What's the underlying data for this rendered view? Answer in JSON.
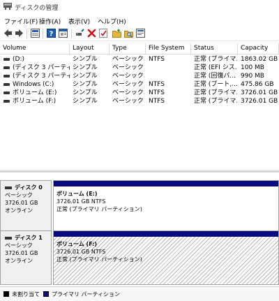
{
  "window": {
    "title": "ディスクの管理"
  },
  "menu": [
    {
      "label": "ファイル(F)"
    },
    {
      "label": "操作(A)"
    },
    {
      "label": "表示(V)"
    },
    {
      "label": "ヘルプ(H)"
    }
  ],
  "toolbar": {
    "icons": [
      "back-arrow-icon",
      "forward-arrow-icon",
      "up-panel-icon",
      "help-icon",
      "properties-icon",
      "connect-icon",
      "delete-x-icon",
      "check-icon",
      "new-folder-icon",
      "search-folder-icon",
      "refresh-panel-icon"
    ],
    "colors": {
      "delete": "#cc1111",
      "folder": "#e8b83a",
      "panel": "#1a5fb4"
    }
  },
  "volumes": {
    "columns": [
      "Volume",
      "Layout",
      "Type",
      "File System",
      "Status",
      "Capacity"
    ],
    "rows": [
      {
        "volume": "(D:)",
        "layout": "シンプル",
        "type": "ベーシック",
        "fs": "NTFS",
        "status": "正常 (プライマ...",
        "capacity": "1863.02 GB"
      },
      {
        "volume": "(ディスク 3 パーティシ...",
        "layout": "シンプル",
        "type": "ベーシック",
        "fs": "",
        "status": "正常 (EFI シス...",
        "capacity": "100 MB"
      },
      {
        "volume": "(ディスク 3 パーティシ...",
        "layout": "シンプル",
        "type": "ベーシック",
        "fs": "",
        "status": "正常 (回復パ...",
        "capacity": "990 MB"
      },
      {
        "volume": "Windows (C:)",
        "layout": "シンプル",
        "type": "ベーシック",
        "fs": "NTFS",
        "status": "正常 (ブート,...",
        "capacity": "475.86 GB"
      },
      {
        "volume": "ボリューム (E:)",
        "layout": "シンプル",
        "type": "ベーシック",
        "fs": "NTFS",
        "status": "正常 (プライマ...",
        "capacity": "3726.01 GB"
      },
      {
        "volume": "ボリューム (F:)",
        "layout": "シンプル",
        "type": "ベーシック",
        "fs": "NTFS",
        "status": "正常 (プライマ...",
        "capacity": "3726.01 GB"
      }
    ]
  },
  "disks": [
    {
      "name": "ディスク 0",
      "type": "ベーシック",
      "size": "3726.01 GB",
      "state": "オンライン",
      "partition": {
        "name": "ボリューム (E:)",
        "size_fs": "3726.01 GB NTFS",
        "status": "正常 (プライマリ パーティション)",
        "hatched": false
      }
    },
    {
      "name": "ディスク 1",
      "type": "ベーシック",
      "size": "3726.01 GB",
      "state": "オンライン",
      "partition": {
        "name": "ボリューム (F:)",
        "size_fs": "3726.01 GB NTFS",
        "status": "正常 (プライマリ パーティション)",
        "hatched": true
      }
    }
  ],
  "legend": [
    {
      "label": "未割り当て",
      "color": "#000000"
    },
    {
      "label": "プライマリ パーティション",
      "color": "#0a0a80"
    }
  ]
}
